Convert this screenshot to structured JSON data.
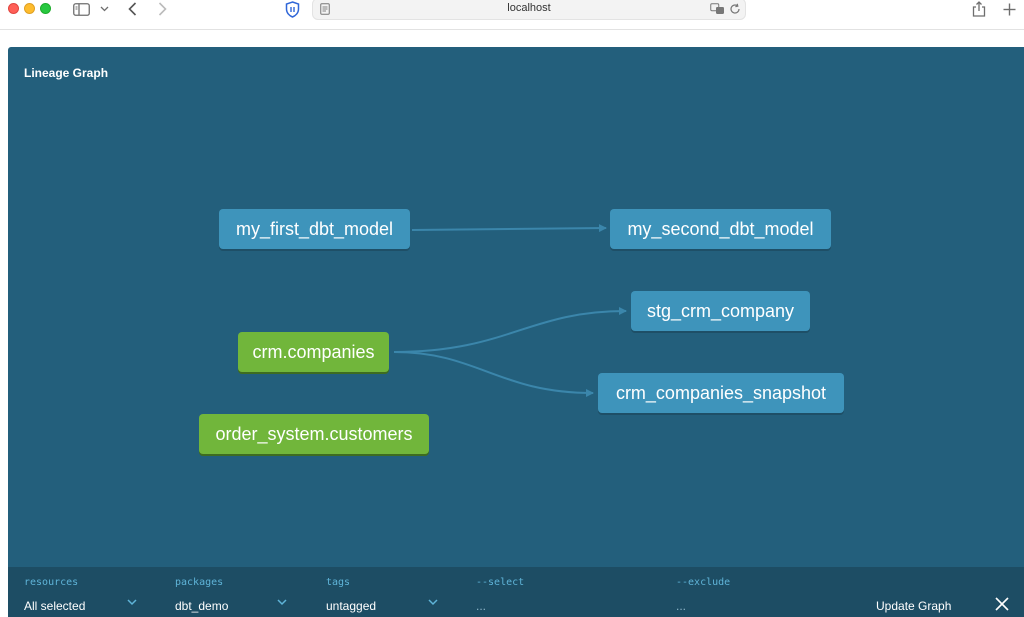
{
  "browser": {
    "url": "localhost"
  },
  "panel": {
    "title": "Lineage Graph"
  },
  "nodes": {
    "my_first_dbt_model": "my_first_dbt_model",
    "my_second_dbt_model": "my_second_dbt_model",
    "stg_crm_company": "stg_crm_company",
    "crm_companies": "crm.companies",
    "crm_companies_snapshot": "crm_companies_snapshot",
    "order_system_customers": "order_system.customers"
  },
  "colors": {
    "panel_bg": "#235f7c",
    "model_node": "#3e94bb",
    "source_node": "#71b63b",
    "edge": "#3b86ab",
    "filter_bar": "#1d4d64"
  },
  "filters": {
    "resources": {
      "label": "resources",
      "value": "All selected"
    },
    "packages": {
      "label": "packages",
      "value": "dbt_demo"
    },
    "tags": {
      "label": "tags",
      "value": "untagged"
    },
    "select": {
      "label": "--select",
      "value": "..."
    },
    "exclude": {
      "label": "--exclude",
      "value": "..."
    },
    "update_button": "Update Graph"
  },
  "icons": [
    "sidebar-icon",
    "chevron-down-icon",
    "back-icon",
    "forward-icon",
    "privacy-shield-icon",
    "reader-icon",
    "translate-icon",
    "reload-icon",
    "share-icon",
    "new-tab-icon",
    "close-icon"
  ]
}
